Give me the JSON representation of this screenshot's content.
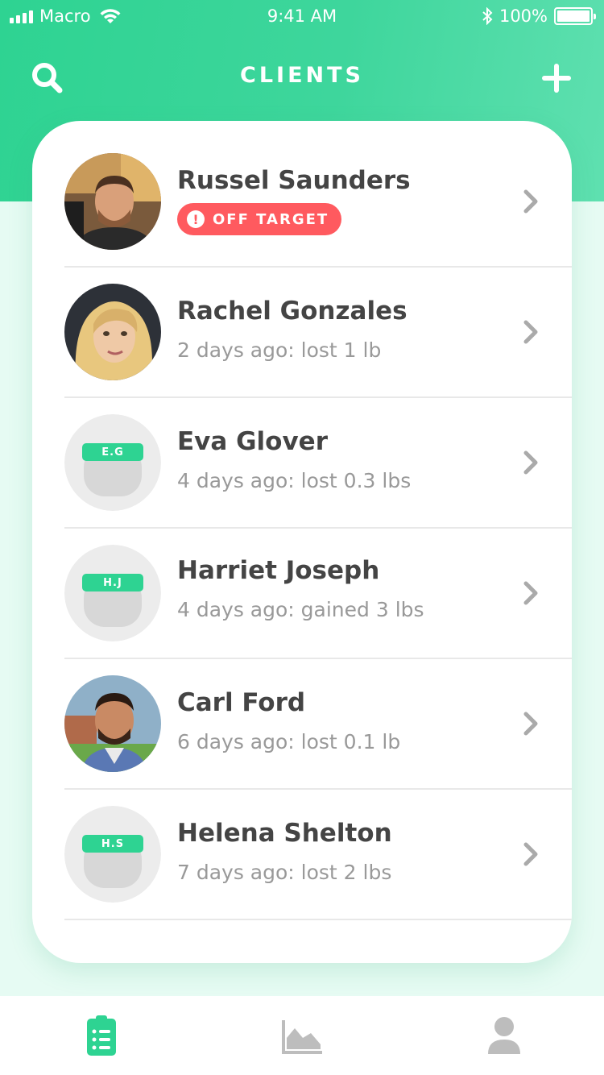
{
  "status_bar": {
    "carrier": "Macro",
    "time": "9:41 AM",
    "battery": "100%"
  },
  "header": {
    "title": "CLIENTS",
    "search_icon": "search-icon",
    "add_icon": "plus-icon"
  },
  "colors": {
    "accent": "#2ed392",
    "alert": "#ff5a5f",
    "background": "#e6fbf3"
  },
  "clients": [
    {
      "name": "Russel Saunders",
      "badge": "OFF TARGET",
      "badge_icon": "!",
      "avatar": "photo"
    },
    {
      "name": "Rachel Gonzales",
      "status": "2 days ago: lost 1 lb",
      "avatar": "photo"
    },
    {
      "name": "Eva Glover",
      "status": "4 days ago: lost 0.3 lbs",
      "avatar": "placeholder",
      "initials": "E.G"
    },
    {
      "name": "Harriet Joseph",
      "status": "4 days ago: gained 3 lbs",
      "avatar": "placeholder",
      "initials": "H.J"
    },
    {
      "name": "Carl Ford",
      "status": "6 days ago: lost 0.1 lb",
      "avatar": "photo"
    },
    {
      "name": "Helena Shelton",
      "status": "7 days ago: lost 2 lbs",
      "avatar": "placeholder",
      "initials": "H.S"
    }
  ],
  "tab_bar": {
    "items": [
      {
        "icon": "clipboard-list-icon",
        "active": true
      },
      {
        "icon": "area-chart-icon",
        "active": false
      },
      {
        "icon": "user-icon",
        "active": false
      }
    ]
  }
}
